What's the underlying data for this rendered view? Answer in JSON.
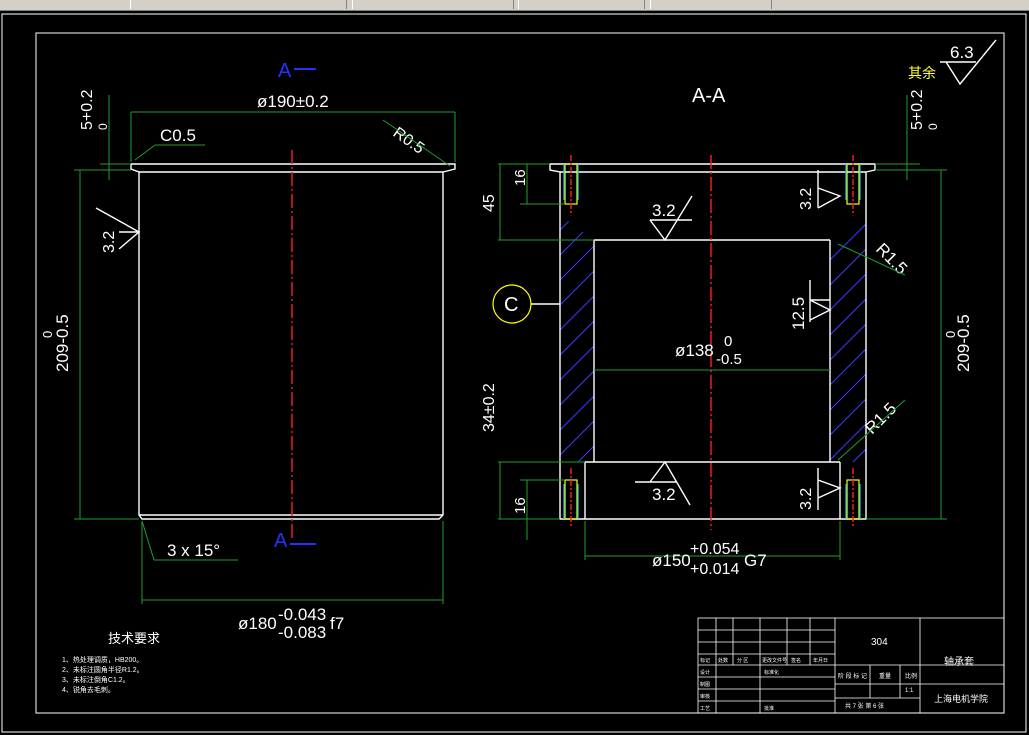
{
  "toolbar": {
    "tabs": [
      "",
      "",
      "",
      "",
      "",
      ""
    ]
  },
  "drawing": {
    "section_marks": {
      "top": "A",
      "bottom": "A"
    },
    "section_title": "A-A",
    "dims": {
      "dia_top": "ø190±0.2",
      "chamfer_top": "C0.5",
      "radius_top": "R0.5",
      "flange_tol_left": "5+0.2\n0",
      "height_left": "209-0.5",
      "height_left_upper": "0",
      "rough_left": "3.2",
      "chamfer_bottom": "3 x 15°",
      "dia_bottom_main": "ø180",
      "dia_bottom_tol_upper": "-0.043",
      "dia_bottom_tol_lower": "-0.083",
      "dia_bottom_fit": "f7",
      "flange_tol_right_a": "5+0.2",
      "flange_tol_right_b": "0",
      "flange_tol_left_a": "5+0.2",
      "flange_tol_left_b": "0",
      "dim_16_top": "16",
      "dim_45": "45",
      "dim_34": "34±0.2",
      "dim_16_bottom": "16",
      "circle_label": "C",
      "rough_center_top": "3.2",
      "rough_right_top": "3.2",
      "radius_right_top": "R1.5",
      "rough_right_mid": "12.5",
      "bore_main": "ø138",
      "bore_upper": "0",
      "bore_lower": "-0.5",
      "height_right": "209-0.5",
      "height_right_upper": "0",
      "radius_right_bottom": "R1.5",
      "rough_center_bottom": "3.2",
      "rough_right_bottom": "3.2",
      "od_main": "ø150",
      "od_upper": "+0.054",
      "od_lower": "+0.014",
      "od_fit": "G7",
      "rough_general": "6.3",
      "rough_general_note": "其余"
    },
    "notes": {
      "title": "技术要求",
      "items": [
        "1、热处理调质，HB200。",
        "2、未标注圆角半径R1.2。",
        "3、未标注倒角C1.2。",
        "4、锐角去毛刺。"
      ]
    },
    "title_block": {
      "drawing_no": "304",
      "part_name": "轴承套",
      "school": "上海电机学院",
      "row_labels": [
        "标记",
        "处数",
        "分 区",
        "更改文件号",
        "签名",
        "年月日"
      ],
      "designer_label": "设计",
      "std_label": "标准化",
      "review_label": "审核",
      "process_label": "工艺",
      "approve_label": "批准",
      "check_label": "制图",
      "stage_labels": [
        "阶 段 标 记",
        "重量",
        "比例"
      ],
      "scale": "1:1",
      "sheets": "共 7 张  第 6 张"
    }
  }
}
